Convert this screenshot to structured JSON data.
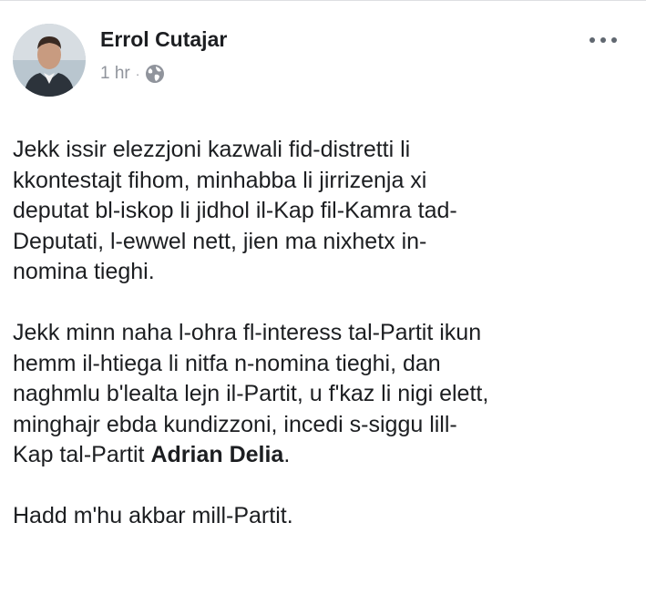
{
  "post": {
    "author": "Errol Cutajar",
    "time": "1 hr",
    "separator": "·",
    "privacy_icon": "globe-icon",
    "more_icon": "ellipsis-icon",
    "paragraphs": {
      "p1": "Jekk issir elezzjoni kazwali fid-distretti li\nkkontestajt fihom, minhabba li jirrizenja xi\ndeputat bl-iskop li jidhol il-Kap fil-Kamra tad-\nDeputati, l-ewwel nett, jien ma nixhetx in-\nnomina tieghi.",
      "p2_main": "Jekk minn naha l-ohra fl-interess tal-Partit ikun\nhemm il-htiega li nitfa n-nomina tieghi, dan\nnaghmlu b'lealta lejn il-Partit, u f'kaz li nigi elett,\nminghajr ebda kundizzoni, incedi s-siggu lill-\nKap tal-Partit ",
      "p2_mention": "Adrian Delia",
      "p2_end": ".",
      "p3": "Hadd m'hu akbar mill-Partit."
    }
  },
  "colors": {
    "text": "#1c1e21",
    "meta": "#90949c"
  }
}
